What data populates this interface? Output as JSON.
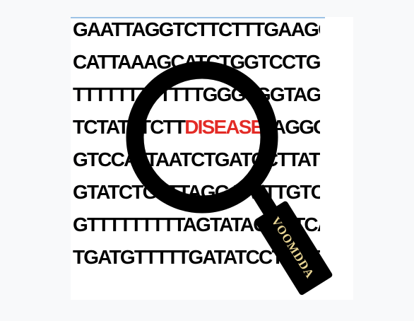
{
  "sequence_lines": [
    {
      "text": "GAATTAGGTCTTCTTTGAAGGTC"
    },
    {
      "text": "CATTAAAGCATCTGGTCCTGGG"
    },
    {
      "text": "TTTTTTTTTTTTGGGTGGTAGAC"
    },
    {
      "before": "TCTATTTCTT",
      "highlight": "DISEASE",
      "after": "TAGGGGA"
    },
    {
      "text": "GTCCATTAATCTGATCCTTATTT"
    },
    {
      "text": "GTATCTGTTTAGGAATTTGTCCA"
    },
    {
      "text": "GTTTTTTTTTAGTATAGCCTCA"
    },
    {
      "text": "TGATGTTTTTGATATCCTCATTTG"
    }
  ],
  "logo": {
    "handle_text": "VOOMDDA",
    "handle_text_color": "#e8d594",
    "lens_color": "#000000",
    "highlight_color": "#e32b26"
  }
}
